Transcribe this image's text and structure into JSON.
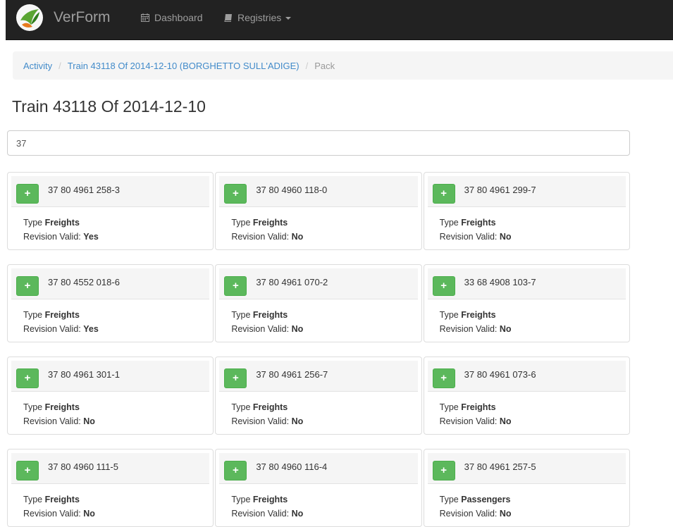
{
  "navbar": {
    "brand": "VerForm",
    "dashboard_label": "Dashboard",
    "registries_label": "Registries"
  },
  "breadcrumb": {
    "activity": "Activity",
    "train": "Train 43118 Of 2014-12-10 (BORGHETTO SULL'ADIGE)",
    "current": "Pack",
    "separator": "/"
  },
  "page_title": "Train 43118 Of 2014-12-10",
  "search": {
    "value": "37"
  },
  "labels": {
    "type_prefix": "Type",
    "revision_prefix": "Revision Valid:",
    "add_button": "+"
  },
  "wagons": [
    {
      "id": "37 80 4961 258-3",
      "type": "Freights",
      "revision": "Yes"
    },
    {
      "id": "37 80 4960 118-0",
      "type": "Freights",
      "revision": "No"
    },
    {
      "id": "37 80 4961 299-7",
      "type": "Freights",
      "revision": "No"
    },
    {
      "id": "37 80 4552 018-6",
      "type": "Freights",
      "revision": "Yes"
    },
    {
      "id": "37 80 4961 070-2",
      "type": "Freights",
      "revision": "No"
    },
    {
      "id": "33 68 4908 103-7",
      "type": "Freights",
      "revision": "No"
    },
    {
      "id": "37 80 4961 301-1",
      "type": "Freights",
      "revision": "No"
    },
    {
      "id": "37 80 4961 256-7",
      "type": "Freights",
      "revision": "No"
    },
    {
      "id": "37 80 4961 073-6",
      "type": "Freights",
      "revision": "No"
    },
    {
      "id": "37 80 4960 111-5",
      "type": "Freights",
      "revision": "No"
    },
    {
      "id": "37 80 4960 116-4",
      "type": "Freights",
      "revision": "No"
    },
    {
      "id": "37 80 4961 257-5",
      "type": "Passengers",
      "revision": "No"
    }
  ],
  "colors": {
    "navbar": "#222222",
    "link": "#428bca",
    "add_button": "#5cb85c"
  },
  "icons": {
    "calendar": "calendar-icon",
    "book": "book-icon",
    "logo": "verform-logo"
  }
}
